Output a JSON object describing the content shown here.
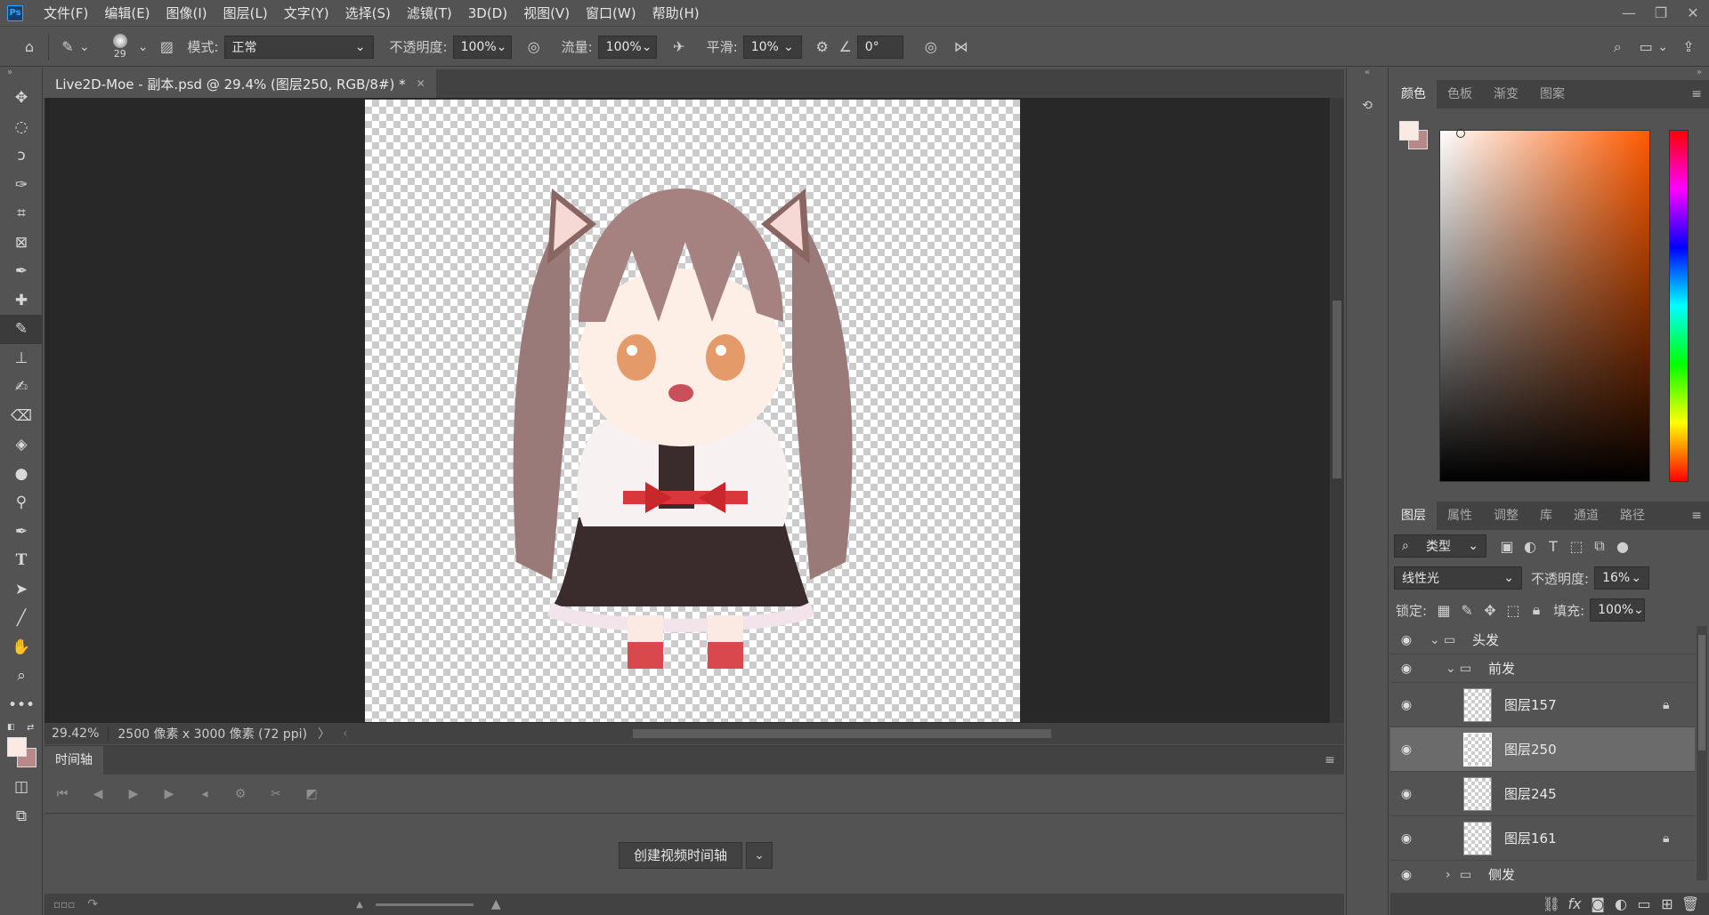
{
  "app": {
    "logo": "Ps",
    "menu": [
      "文件(F)",
      "编辑(E)",
      "图像(I)",
      "图层(L)",
      "文字(Y)",
      "选择(S)",
      "滤镜(T)",
      "3D(D)",
      "视图(V)",
      "窗口(W)",
      "帮助(H)"
    ],
    "window_controls": [
      "—",
      "❐",
      "✕"
    ]
  },
  "options": {
    "brush_size": "29",
    "mode_label": "模式:",
    "mode_value": "正常",
    "opacity_label": "不透明度:",
    "opacity_value": "100%",
    "flow_label": "流量:",
    "flow_value": "100%",
    "smoothing_label": "平滑:",
    "smoothing_value": "10%",
    "angle_value": "0°"
  },
  "document": {
    "tab_title": "Live2D-Moe - 副本.psd @ 29.4% (图层250, RGB/8#) *",
    "zoom": "29.42%",
    "size_info": "2500 像素 x 3000 像素 (72 ppi)"
  },
  "timeline": {
    "title": "时间轴",
    "create_button": "创建视频时间轴"
  },
  "color_panel": {
    "tabs": [
      "颜色",
      "色板",
      "渐变",
      "图案"
    ],
    "foreground": "#fbe9e4",
    "background": "#b98888"
  },
  "layers_panel": {
    "tabs": [
      "图层",
      "属性",
      "调整",
      "库",
      "通道",
      "路径"
    ],
    "filter_label": "类型",
    "blend_mode": "线性光",
    "opacity_label": "不透明度:",
    "opacity_value": "16%",
    "lock_label": "锁定:",
    "fill_label": "填充:",
    "fill_value": "100%",
    "groups": [
      {
        "name": "头发"
      },
      {
        "name": "前发"
      }
    ],
    "layers": [
      {
        "name": "图层157",
        "locked": true,
        "selected": false
      },
      {
        "name": "图层250",
        "locked": false,
        "selected": true
      },
      {
        "name": "图层245",
        "locked": false,
        "selected": false
      },
      {
        "name": "图层161",
        "locked": true,
        "selected": false
      }
    ],
    "partial_group": "侧发"
  },
  "colors": {
    "ui_bg": "#535353",
    "panel_dark": "#424242",
    "canvas_bg": "#282828",
    "accent": "#31a8ff"
  }
}
